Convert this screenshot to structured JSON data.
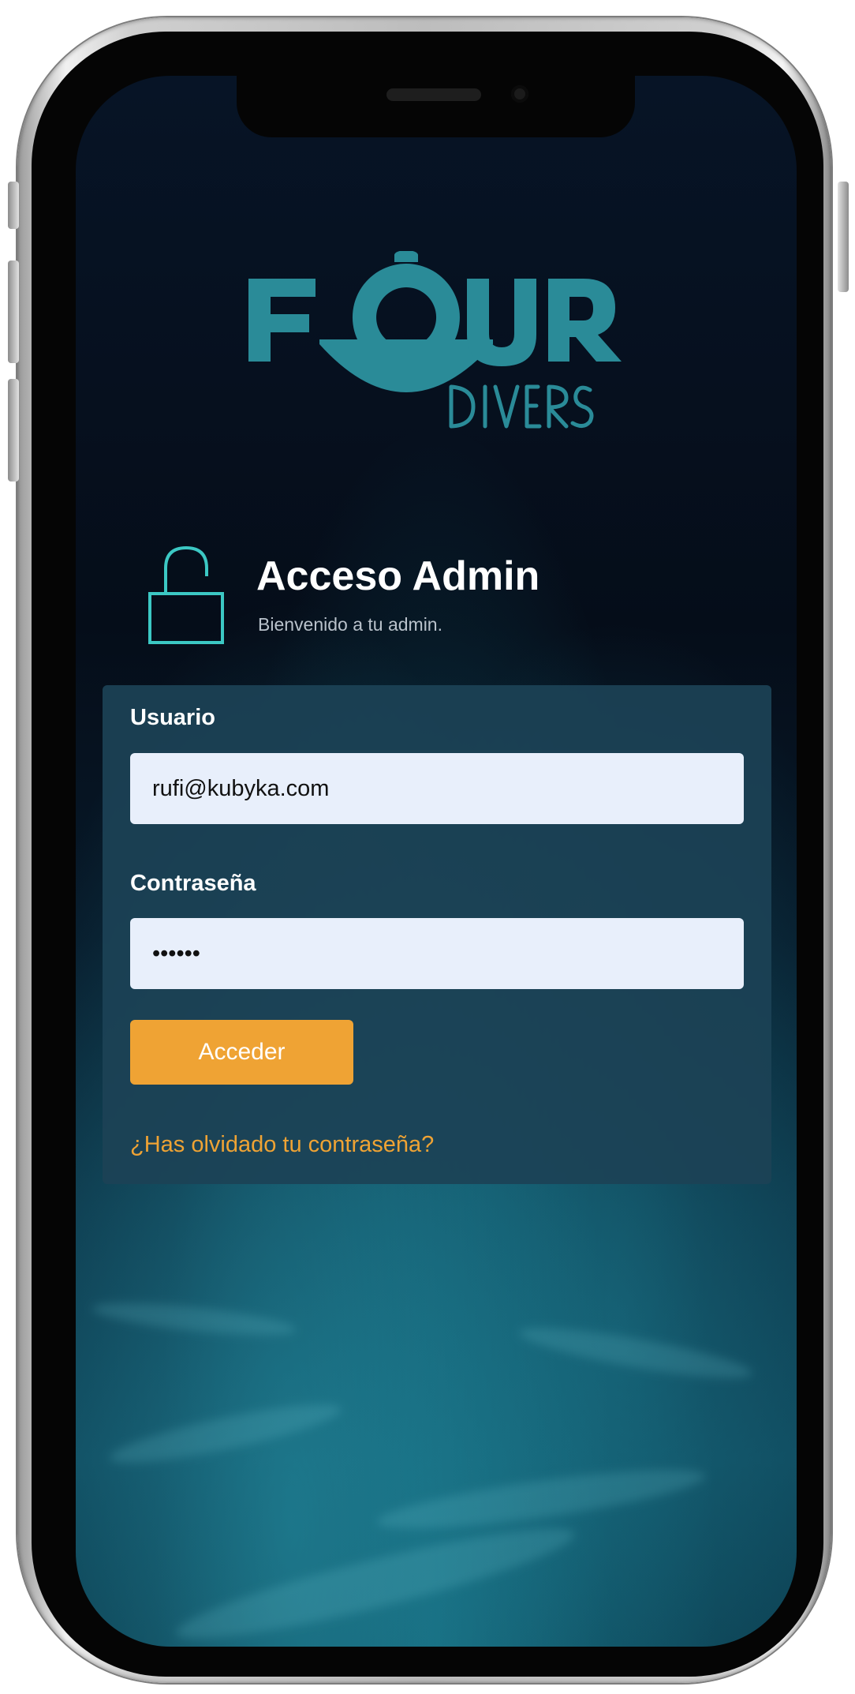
{
  "logo": {
    "brand_word": "FOUR",
    "brand_sub": "DIVERS",
    "color": "#2a8b98"
  },
  "header": {
    "title": "Acceso Admin",
    "subtitle": "Bienvenido a tu admin.",
    "icon": "unlock-icon"
  },
  "form": {
    "user_label": "Usuario",
    "user_value": "rufi@kubyka.com",
    "password_label": "Contraseña",
    "password_value": "••••••",
    "submit_label": "Acceder",
    "forgot_label": "¿Has olvidado tu contraseña?"
  },
  "colors": {
    "accent": "#efa334",
    "brand_teal": "#2a8b98",
    "lock_teal": "#3cc8c4",
    "card": "#1c4256",
    "input_bg": "#e8effb"
  }
}
